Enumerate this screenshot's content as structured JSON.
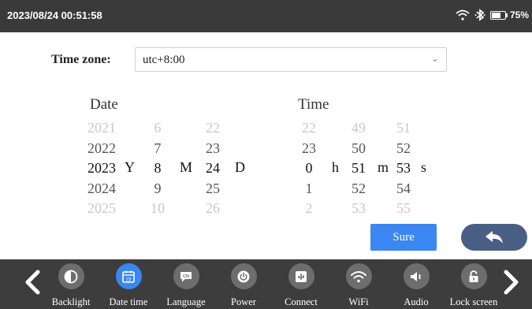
{
  "status_bar": {
    "datetime": "2023/08/24 00:51:58",
    "battery_percent": "75%",
    "battery_level": 0.75
  },
  "timezone": {
    "label": "Time zone:",
    "value": "utc+8:00"
  },
  "date": {
    "heading": "Date",
    "year": [
      "2021",
      "2022",
      "2023",
      "2024",
      "2025"
    ],
    "month": [
      "6",
      "7",
      "8",
      "9",
      "10"
    ],
    "day": [
      "22",
      "23",
      "24",
      "25",
      "26"
    ],
    "units": {
      "year": "Y",
      "month": "M",
      "day": "D"
    }
  },
  "time": {
    "heading": "Time",
    "hour": [
      "22",
      "23",
      "0",
      "1",
      "2"
    ],
    "minute": [
      "49",
      "50",
      "51",
      "52",
      "53"
    ],
    "second": [
      "51",
      "52",
      "53",
      "54",
      "55"
    ],
    "units": {
      "hour": "h",
      "minute": "m",
      "second": "s"
    }
  },
  "buttons": {
    "sure": "Sure"
  },
  "toolbar": {
    "items": [
      {
        "label": "Backlight",
        "icon": "backlight-icon"
      },
      {
        "label": "Date time",
        "icon": "calendar-icon",
        "badge": "23",
        "active": true
      },
      {
        "label": "Language",
        "icon": "language-icon",
        "badge": "CN"
      },
      {
        "label": "Power",
        "icon": "power-icon"
      },
      {
        "label": "Connect",
        "icon": "connect-icon"
      },
      {
        "label": "WiFi",
        "icon": "wifi-icon"
      },
      {
        "label": "Audio",
        "icon": "audio-icon"
      },
      {
        "label": "Lock screen",
        "icon": "lock-icon"
      }
    ]
  },
  "colors": {
    "accent": "#3b86f0",
    "status_bar": "#3a3a3a",
    "toolbar": "#3d3d3d",
    "back_button": "#4a5f86"
  }
}
